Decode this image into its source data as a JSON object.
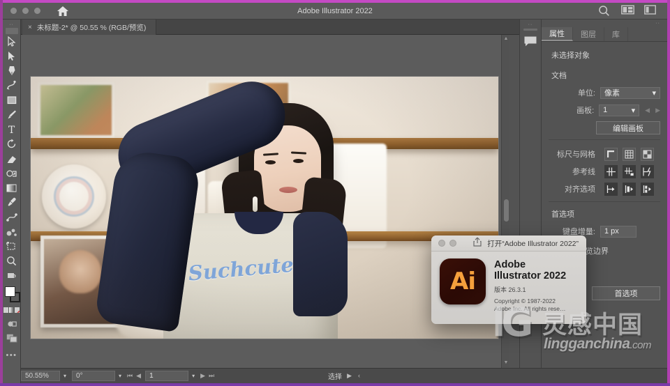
{
  "window": {
    "app_title": "Adobe Illustrator 2022",
    "traffic_lights": [
      "close",
      "minimize",
      "zoom"
    ],
    "home_icon": "home-icon",
    "right_icons": [
      "search-icon",
      "arrange-documents-icon",
      "workspace-switcher-icon"
    ]
  },
  "document_tab": {
    "close_glyph": "×",
    "label": "未标题-2* @ 50.55 % (RGB/预览)"
  },
  "toolbar": {
    "grip": "··",
    "tools": [
      {
        "name": "selection-tool",
        "glyph": "selection"
      },
      {
        "name": "direct-selection-tool",
        "glyph": "direct-selection"
      },
      {
        "name": "pen-tool",
        "glyph": "pen"
      },
      {
        "name": "curvature-tool",
        "glyph": "curvature"
      },
      {
        "name": "rectangle-tool",
        "glyph": "rectangle"
      },
      {
        "name": "paintbrush-tool",
        "glyph": "paintbrush"
      },
      {
        "name": "type-tool",
        "glyph": "type"
      },
      {
        "name": "rotate-tool",
        "glyph": "rotate"
      },
      {
        "name": "eraser-tool",
        "glyph": "eraser"
      },
      {
        "name": "shape-builder-tool",
        "glyph": "shape-builder"
      },
      {
        "name": "gradient-tool",
        "glyph": "gradient"
      },
      {
        "name": "eyedropper-tool",
        "glyph": "eyedropper"
      },
      {
        "name": "blend-tool",
        "glyph": "blend"
      },
      {
        "name": "symbol-sprayer-tool",
        "glyph": "symbol-sprayer"
      },
      {
        "name": "artboard-tool",
        "glyph": "artboard"
      },
      {
        "name": "zoom-tool",
        "glyph": "zoom"
      },
      {
        "name": "hand-tool",
        "glyph": "hand"
      }
    ],
    "fill_color": "#ffffff",
    "stroke_color": "#000000",
    "more_tools": "•••"
  },
  "canvas": {
    "artboard_label": "artboard-1",
    "photo_alt": "photo of a young woman with raised arm in a room with shelves",
    "shirt_text": "Suchcute"
  },
  "panel": {
    "tabs": [
      {
        "label": "属性",
        "active": true
      },
      {
        "label": "图层",
        "active": false
      },
      {
        "label": "库",
        "active": false
      }
    ],
    "no_selection": "未选择对象",
    "document_section": "文档",
    "unit_label": "单位:",
    "unit_value": "像素",
    "artboard_label": "画板:",
    "artboard_value": "1",
    "edit_artboard_button": "编辑画板",
    "rulers_label": "标尺与网格",
    "rulers_icons": [
      "show-rulers-icon",
      "show-grid-icon",
      "show-transparency-grid-icon"
    ],
    "guides_label": "参考线",
    "guides_icons": [
      "show-guides-icon",
      "lock-guides-icon",
      "smart-guides-icon"
    ],
    "snap_label": "对齐选项",
    "snap_icons": [
      "snap-to-point-icon",
      "snap-to-grid-icon",
      "snap-to-pixel-icon"
    ],
    "preferences_section": "首选项",
    "keyboard_increment_label": "键盘增量:",
    "keyboard_increment_value": "1 px",
    "preview_bounds_label": "使用预览边界",
    "preview_bounds_checked": false,
    "preferences_button": "首选项"
  },
  "statusbar": {
    "zoom_value": "50.55%",
    "rotation_value": "0°",
    "page_value": "1",
    "tool_status": "选择",
    "nav_first": "⏮",
    "nav_prev": "◀",
    "nav_next": "▶",
    "nav_last": "⏭",
    "play_glyph": "▶",
    "more_glyph": "‹"
  },
  "dialog": {
    "title": "打开“Adobe Illustrator 2022”",
    "share_icon": "share-icon",
    "traffic_lights": [
      "close",
      "minimize"
    ],
    "app_icon_text": "Ai",
    "heading_line1": "Adobe",
    "heading_line2": "Illustrator 2022",
    "version": "版本 26.3.1",
    "copyright_line1": "Copyright © 1987-2022",
    "copyright_line2": "Adobe Inc.  All rights rese…"
  },
  "watermark": {
    "logo": "lG",
    "chinese": "灵感中国",
    "domain_main": "lingganchina",
    "domain_tld": ".com"
  },
  "colors": {
    "frame_purple": "#b13fb1",
    "chrome_gray": "#535353",
    "panel_gray": "#5a5a5a",
    "accent_orange": "#f5a03c",
    "ai_dark": "#2b0a05"
  }
}
